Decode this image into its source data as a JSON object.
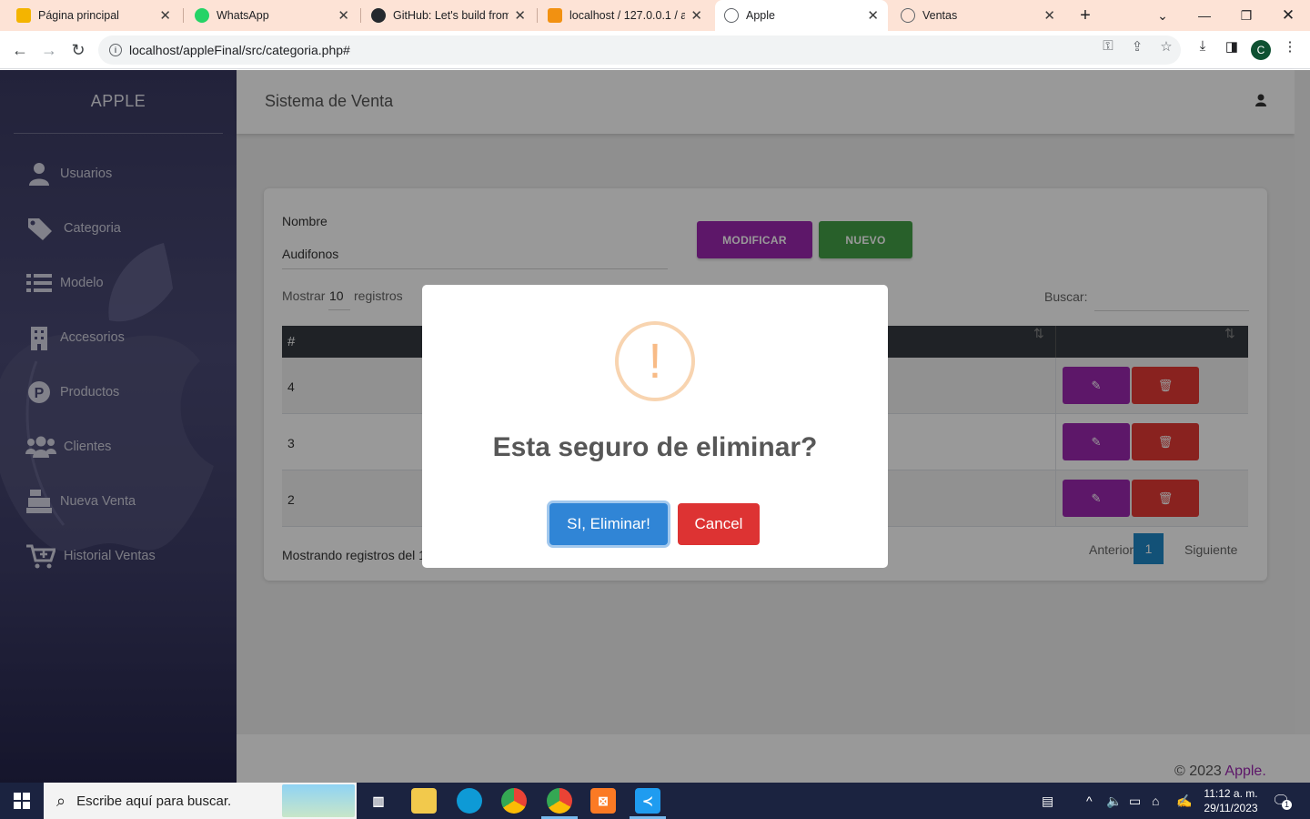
{
  "browser": {
    "tabs": [
      {
        "title": "Página principal",
        "icon": "google-sites-icon",
        "color": "#f4b400"
      },
      {
        "title": "WhatsApp",
        "icon": "whatsapp-icon",
        "color": "#25d366"
      },
      {
        "title": "GitHub: Let's build from",
        "icon": "github-icon",
        "color": "#24292e"
      },
      {
        "title": "localhost / 127.0.0.1 / a",
        "icon": "phpmyadmin-icon",
        "color": "#f29111"
      },
      {
        "title": "Apple",
        "icon": "globe-icon",
        "color": "#5f6368"
      },
      {
        "title": "Ventas",
        "icon": "globe-icon",
        "color": "#5f6368"
      }
    ],
    "new_tab": "+",
    "url": "localhost/appleFinal/src/categoria.php#",
    "profile_initial": "C"
  },
  "sidebar": {
    "brand": "APPLE",
    "items": [
      {
        "label": "Usuarios",
        "icon": "user-icon"
      },
      {
        "label": "Categoria",
        "icon": "tags-icon"
      },
      {
        "label": "Modelo",
        "icon": "list-icon"
      },
      {
        "label": "Accesorios",
        "icon": "building-icon"
      },
      {
        "label": "Productos",
        "icon": "product-p-icon"
      },
      {
        "label": "Clientes",
        "icon": "users-icon"
      },
      {
        "label": "Nueva Venta",
        "icon": "cash-register-icon"
      },
      {
        "label": "Historial Ventas",
        "icon": "cart-plus-icon"
      }
    ]
  },
  "topbar": {
    "title": "Sistema de Venta"
  },
  "form": {
    "nombre_label": "Nombre",
    "nombre_value": "Audifonos",
    "modificar": "MODIFICAR",
    "nuevo": "NUEVO"
  },
  "table": {
    "show_prefix": "Mostrar",
    "show_value": "10",
    "show_suffix": "registros",
    "search_label": "Buscar:",
    "header_id": "#",
    "rows": [
      {
        "id": "4"
      },
      {
        "id": "3"
      },
      {
        "id": "2"
      }
    ],
    "info": "Mostrando registros del 1",
    "prev": "Anterior",
    "page": "1",
    "next": "Siguiente"
  },
  "footer": {
    "text": "© 2023 ",
    "brand": "Apple."
  },
  "modal": {
    "icon": "!",
    "title": "Esta seguro de eliminar?",
    "confirm": "SI, Eliminar!",
    "cancel": "Cancel"
  },
  "taskbar": {
    "search_placeholder": "Escribe aquí para buscar.",
    "time": "11:12 a. m.",
    "date": "29/11/2023",
    "notifications": "1"
  },
  "colors": {
    "purple": "#9c27b0",
    "green": "#43a047",
    "red": "#d32f2f",
    "confirm_blue": "#3085d6",
    "cancel_red": "#d33"
  }
}
